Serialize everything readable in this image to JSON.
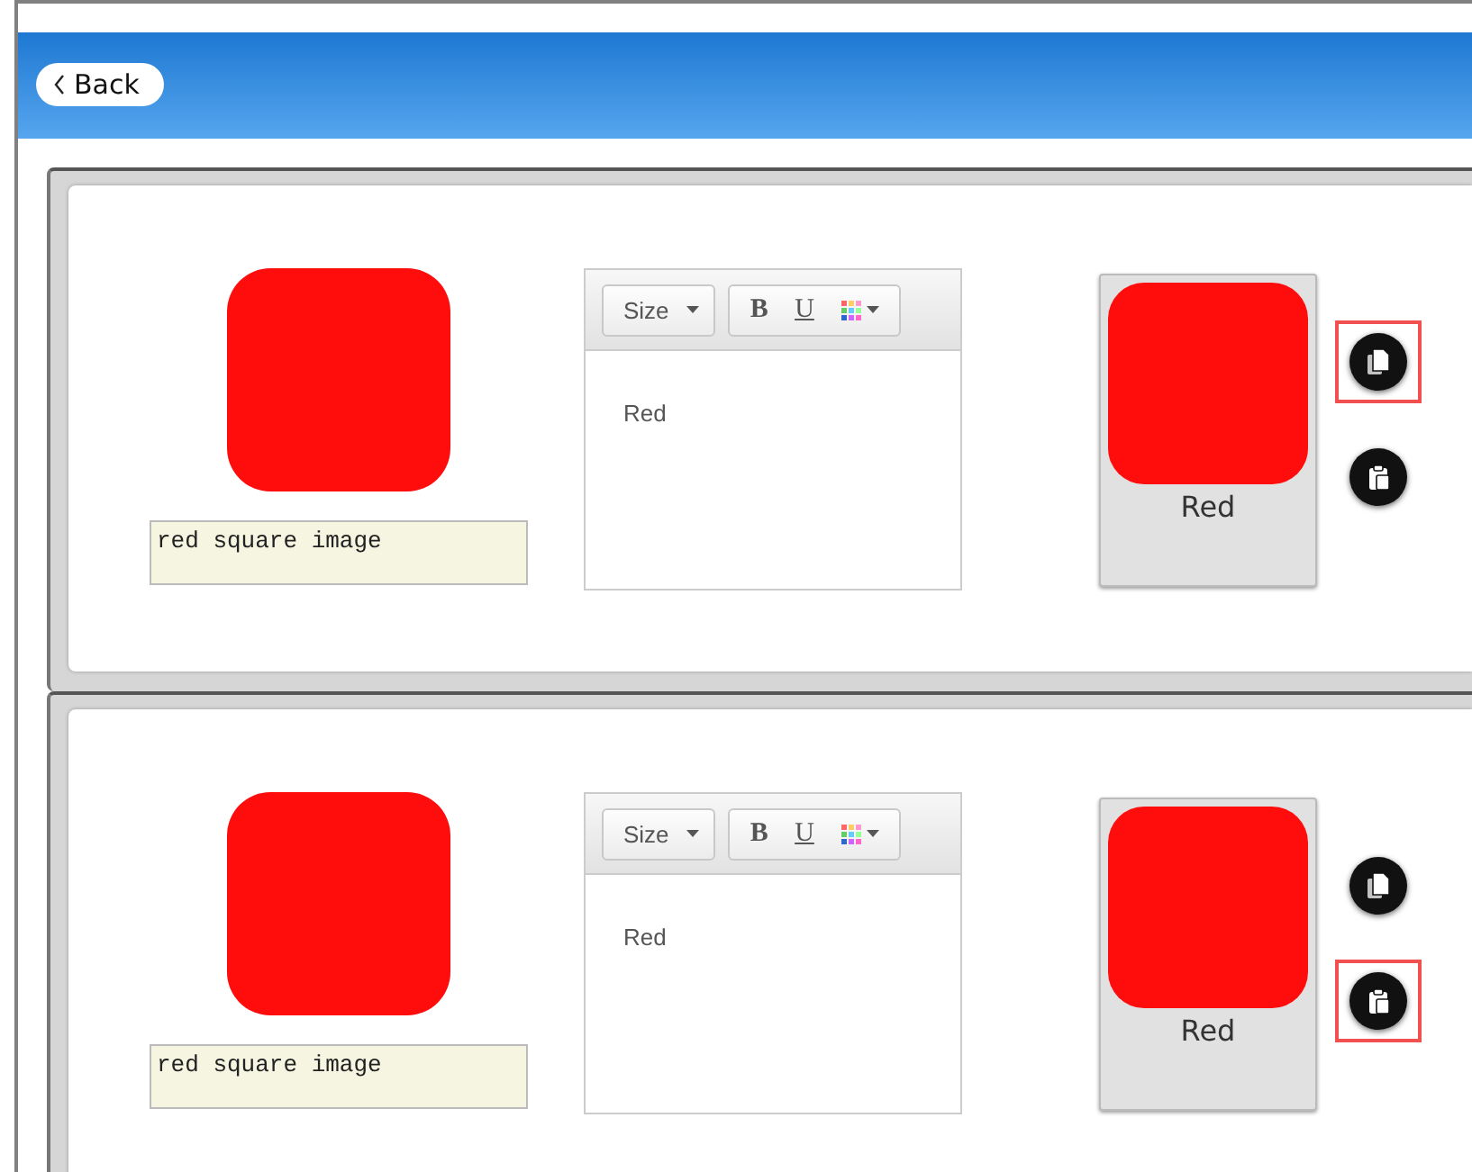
{
  "header": {
    "back_label": "Back"
  },
  "rows": [
    {
      "image_alt": "red square image",
      "editor": {
        "size_label": "Size",
        "bold_label": "B",
        "underline_label": "U",
        "text": "Red"
      },
      "preview_label": "Red",
      "actions": [
        {
          "kind": "copy",
          "highlighted": true
        },
        {
          "kind": "paste",
          "highlighted": false
        }
      ]
    },
    {
      "image_alt": "red square image",
      "editor": {
        "size_label": "Size",
        "bold_label": "B",
        "underline_label": "U",
        "text": "Red"
      },
      "preview_label": "Red",
      "actions": [
        {
          "kind": "copy",
          "highlighted": false
        },
        {
          "kind": "paste",
          "highlighted": true
        }
      ]
    }
  ]
}
